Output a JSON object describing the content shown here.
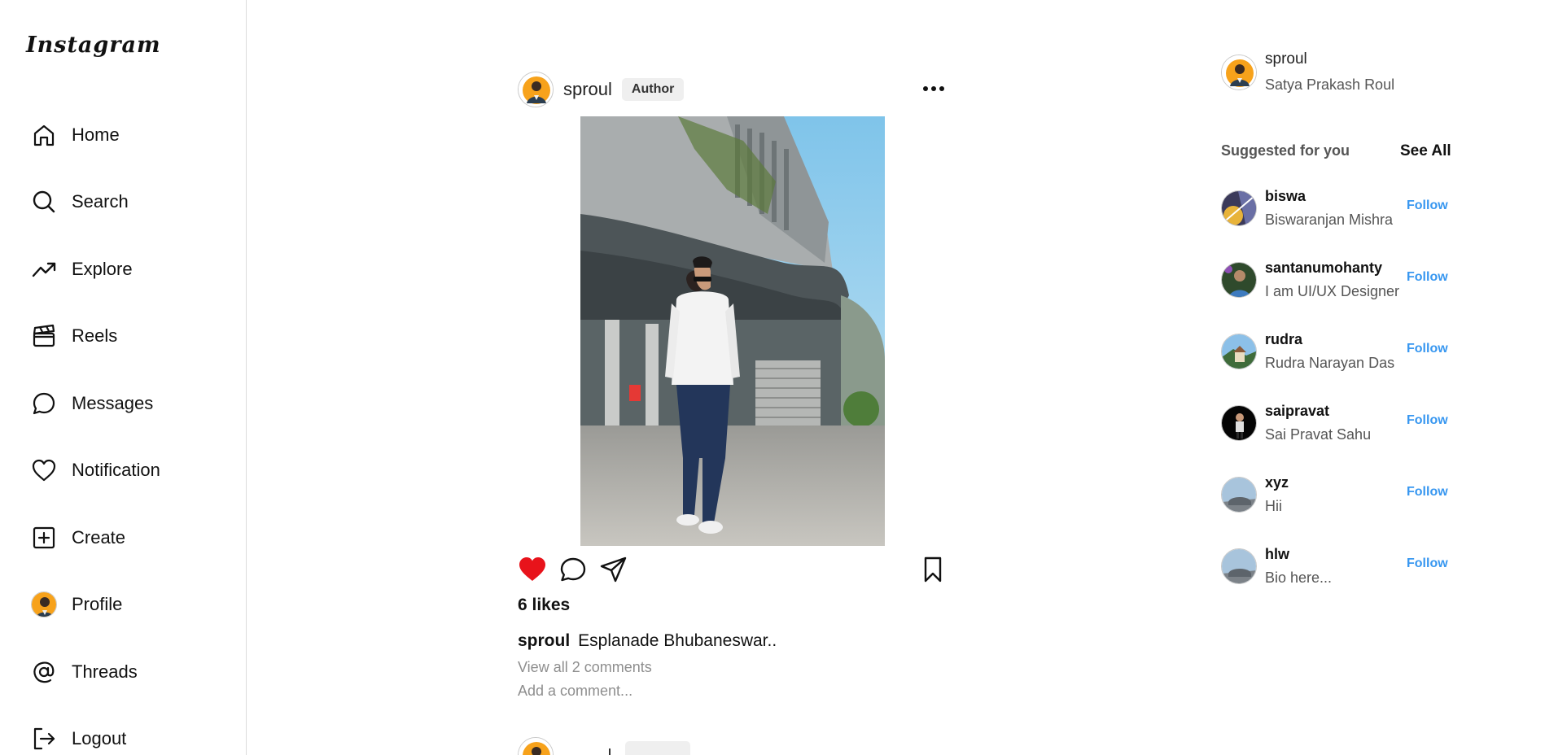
{
  "app": {
    "logo": "Instagram"
  },
  "sidebar": {
    "items": [
      {
        "label": "Home",
        "icon": "home-icon"
      },
      {
        "label": "Search",
        "icon": "search-icon"
      },
      {
        "label": "Explore",
        "icon": "trending-icon"
      },
      {
        "label": "Reels",
        "icon": "clapperboard-icon"
      },
      {
        "label": "Messages",
        "icon": "message-bubble-icon"
      },
      {
        "label": "Notification",
        "icon": "heart-icon"
      },
      {
        "label": "Create",
        "icon": "plus-square-icon"
      },
      {
        "label": "Profile",
        "icon": "avatar"
      },
      {
        "label": "Threads",
        "icon": "at-sign-icon"
      },
      {
        "label": "Logout",
        "icon": "logout-icon"
      }
    ]
  },
  "post": {
    "username": "sproul",
    "badge": "Author",
    "likes": "6 likes",
    "caption_user": "sproul",
    "caption_text": "Esplanade Bhubaneswar..",
    "view_comments": "View all 2 comments",
    "comment_placeholder": "Add a comment...",
    "liked": true,
    "like_color": "#e8131b"
  },
  "current_user": {
    "username": "sproul",
    "full_name": "Satya Prakash Roul"
  },
  "suggestions": {
    "title": "Suggested for you",
    "see_all": "See All",
    "follow_label": "Follow",
    "follow_color": "#3897f0",
    "users": [
      {
        "username": "biswa",
        "full_name": "Biswaranjan Mishra"
      },
      {
        "username": "santanumohanty",
        "full_name": "I am UI/UX Designer"
      },
      {
        "username": "rudra",
        "full_name": "Rudra Narayan Das"
      },
      {
        "username": "saipravat",
        "full_name": "Sai Pravat Sahu"
      },
      {
        "username": "xyz",
        "full_name": "Hii"
      },
      {
        "username": "hlw",
        "full_name": "Bio here..."
      }
    ]
  }
}
